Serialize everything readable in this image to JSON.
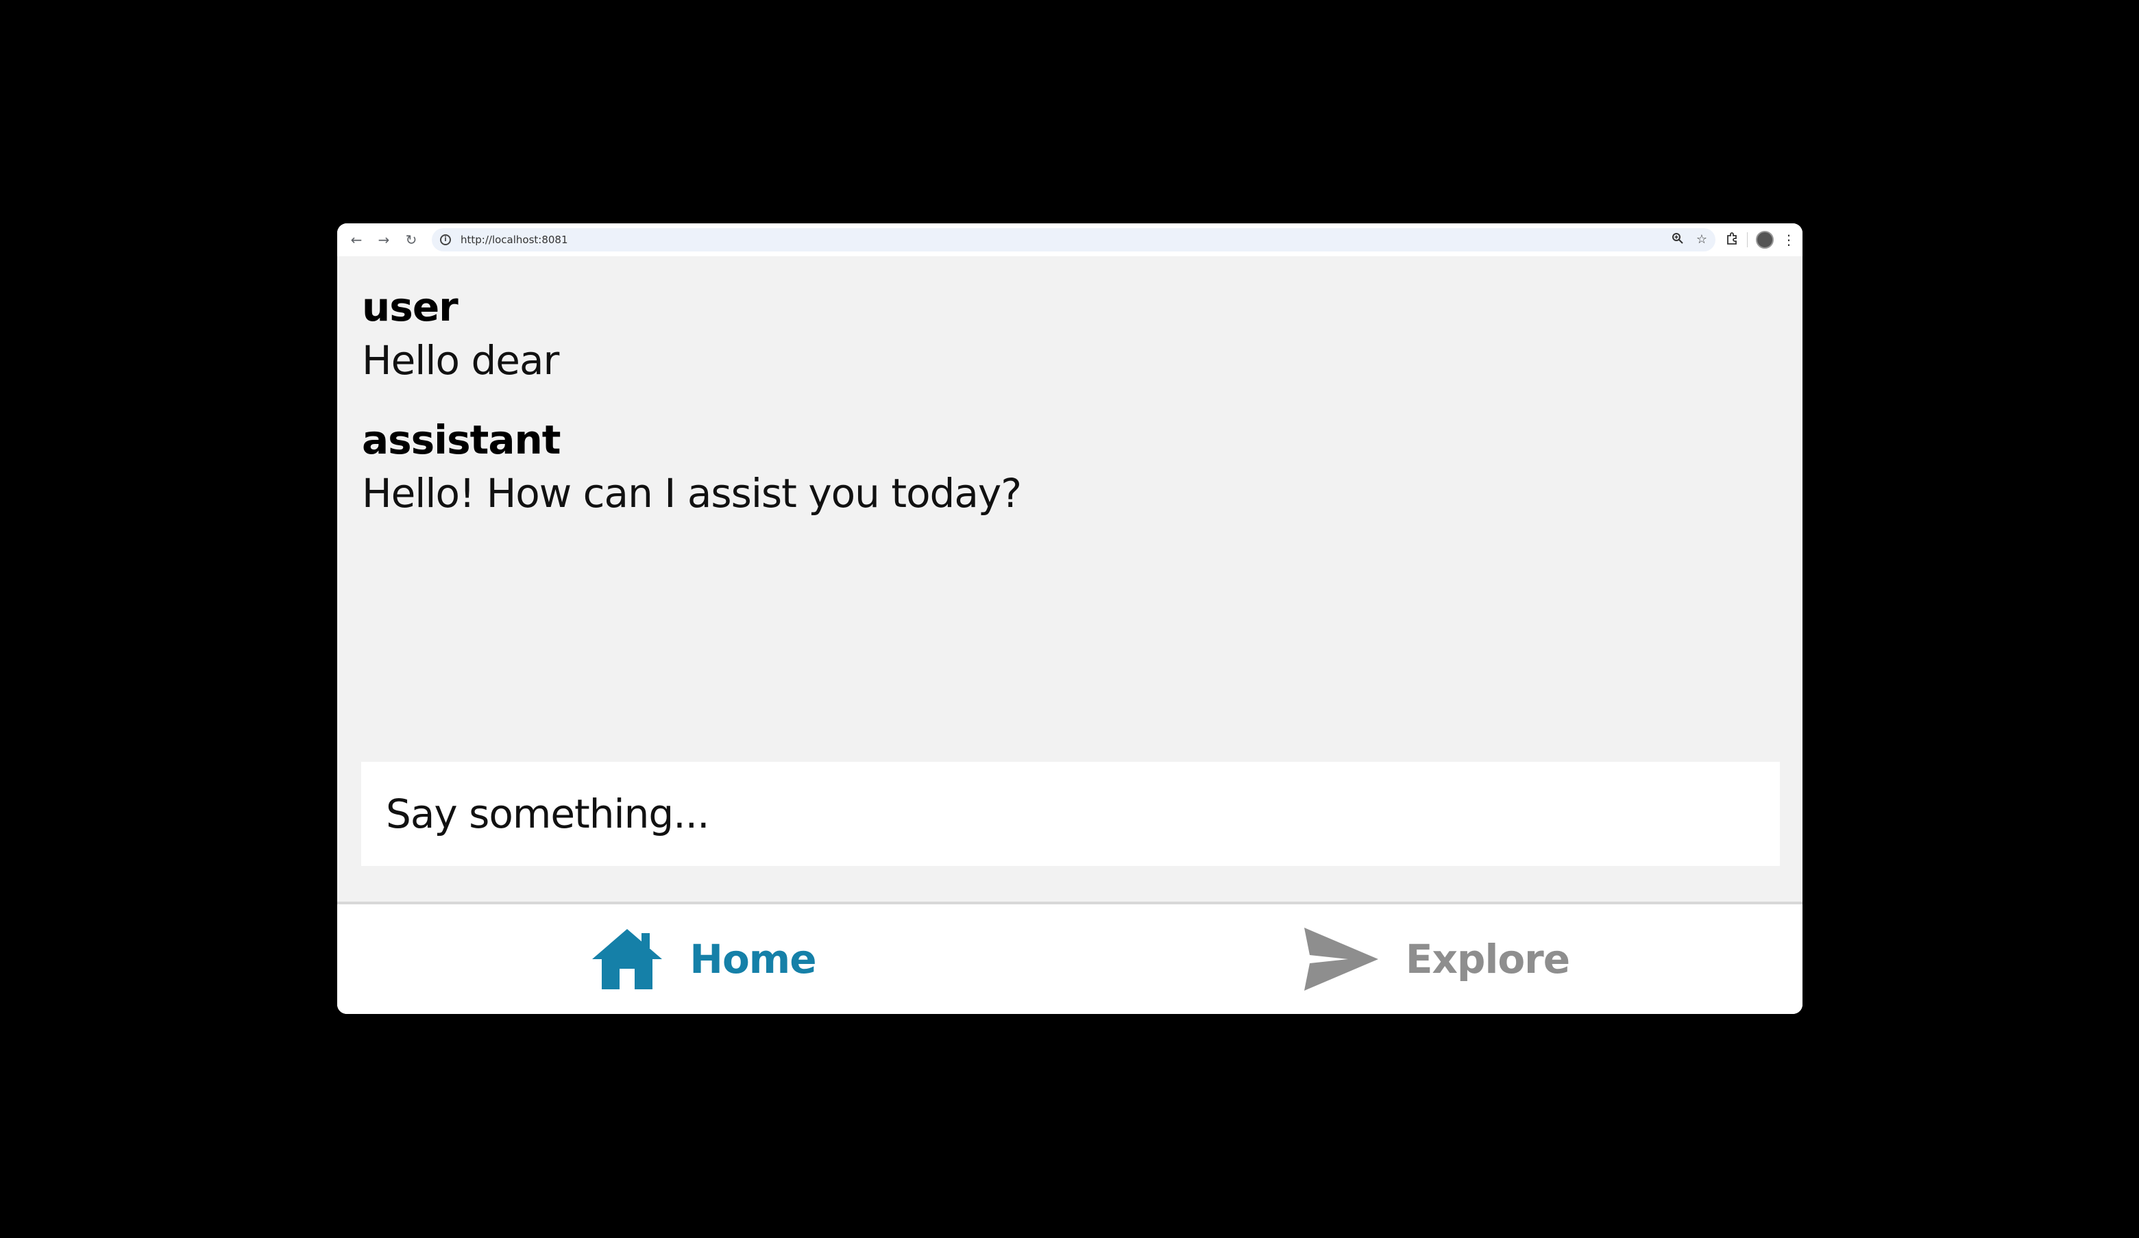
{
  "browser": {
    "url": "http://localhost:8081"
  },
  "chat": {
    "messages": [
      {
        "role": "user",
        "text": "Hello dear"
      },
      {
        "role": "assistant",
        "text": "Hello! How can I assist you today?"
      }
    ]
  },
  "input": {
    "placeholder": "Say something..."
  },
  "nav": {
    "items": [
      {
        "label": "Home",
        "icon": "home-icon",
        "state": "active"
      },
      {
        "label": "Explore",
        "icon": "send-icon",
        "state": "inactive"
      }
    ]
  },
  "colors": {
    "active": "#1580a8",
    "inactive": "#8e8e8e",
    "page_background": "#f2f2f2"
  }
}
